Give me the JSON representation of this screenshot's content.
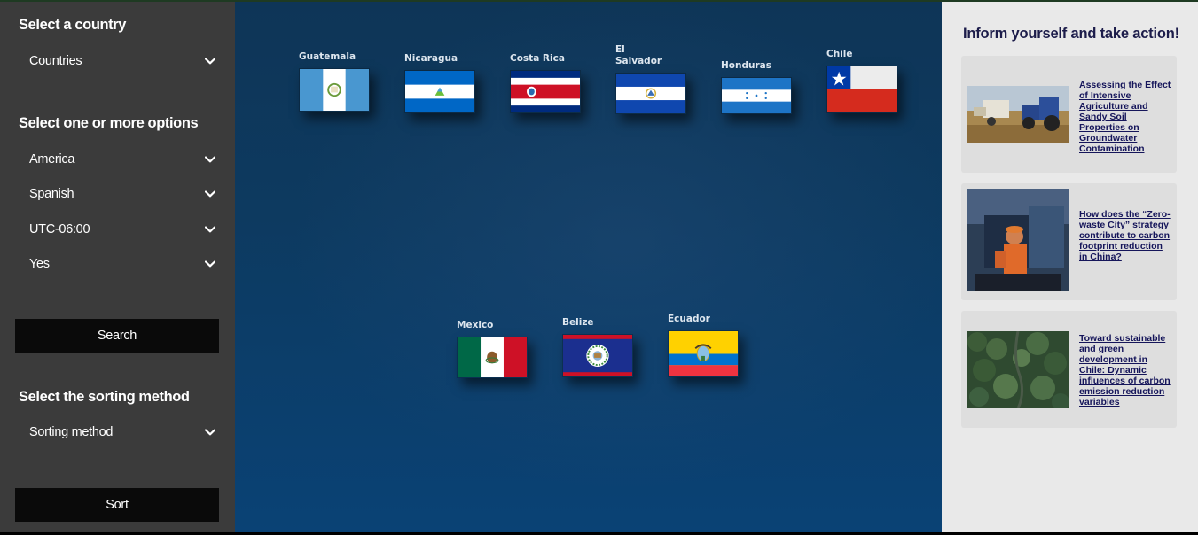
{
  "sidebar": {
    "country_heading": "Select a country",
    "country_select": "Countries",
    "options_heading": "Select one or more options",
    "options": [
      "America",
      "Spanish",
      "UTC-06:00",
      "Yes"
    ],
    "search_label": "Search",
    "sort_heading": "Select the sorting method",
    "sort_select": "Sorting method",
    "sort_label": "Sort"
  },
  "countries": [
    {
      "name": "Guatemala"
    },
    {
      "name": "Nicaragua"
    },
    {
      "name": "Costa Rica"
    },
    {
      "name": "El Salvador"
    },
    {
      "name": "Honduras"
    },
    {
      "name": "Chile"
    },
    {
      "name": "Mexico"
    },
    {
      "name": "Belize"
    },
    {
      "name": "Ecuador"
    }
  ],
  "aside": {
    "title": "Inform yourself and take action!",
    "articles": [
      {
        "title": "Assessing the Effect of Intensive Agriculture and Sandy Soil Properties on Groundwater Contamination",
        "image": "tractor-harvest-photo"
      },
      {
        "title": "How does the “Zero-waste City” strategy contribute to carbon footprint reduction in China?",
        "image": "waste-worker-photo"
      },
      {
        "title": "Toward sustainable and green development in Chile: Dynamic influences of carbon emission reduction variables",
        "image": "forest-aerial-photo"
      }
    ]
  },
  "colors": {
    "sidebar_bg": "#3b3b3b",
    "button_bg": "#0a0a0a",
    "main_bg": "#0d3a60",
    "aside_bg": "#e9e9e9",
    "link_color": "#15155a"
  }
}
